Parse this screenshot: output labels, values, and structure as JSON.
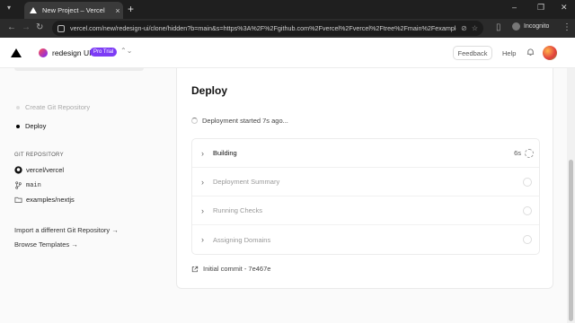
{
  "browser": {
    "tab_title": "New Project – Vercel",
    "tab_close": "×",
    "new_tab": "+",
    "url": "vercel.com/new/redesign-ui/clone/hidden?b=main&s=https%3A%2F%2Fgithub.com%2Fvercel%2Fvercel%2Ftree%2Fmain%2Fexamples%...",
    "incognito_label": "Incognito",
    "minimize": "–",
    "maximize": "❐",
    "close": "✕",
    "back": "←",
    "forward": "→",
    "reload": "↻",
    "menu": "⋮"
  },
  "header": {
    "project_name": "redesign UI",
    "plan_badge": "Pro Trial",
    "chevrons": "⌃⌄",
    "feedback_label": "Feedback",
    "help_label": "Help"
  },
  "sidebar": {
    "steps": [
      {
        "label": "Create Git Repository",
        "active": false
      },
      {
        "label": "Deploy",
        "active": true
      }
    ],
    "section_label": "GIT REPOSITORY",
    "repo": "vercel/vercel",
    "branch": "main",
    "path": "examples/nextjs",
    "import_link": "Import a different Git Repository →",
    "templates_link": "Browse Templates →"
  },
  "deploy": {
    "title": "Deploy",
    "status": "Deployment started 7s ago...",
    "steps": [
      {
        "label": "Building",
        "time": "6s",
        "state": "running"
      },
      {
        "label": "Deployment Summary",
        "time": "",
        "state": "pending"
      },
      {
        "label": "Running Checks",
        "time": "",
        "state": "pending"
      },
      {
        "label": "Assigning Domains",
        "time": "",
        "state": "pending"
      }
    ],
    "commit": "Initial commit - 7e467e"
  }
}
